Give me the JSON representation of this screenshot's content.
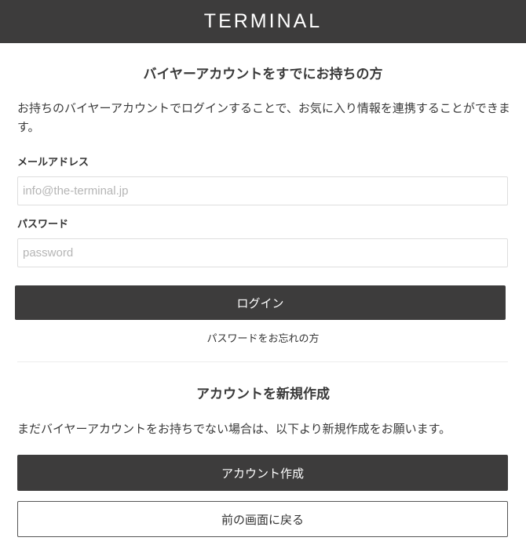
{
  "header": {
    "logo": "TERMINAL",
    "background_color": "#3d3c3c"
  },
  "login_section": {
    "title": "バイヤーアカウントをすでにお持ちの方",
    "description": "お持ちのバイヤーアカウントでログインすることで、お気に入り情報を連携することができます。",
    "email_label": "メールアドレス",
    "email_placeholder": "info@the-terminal.jp",
    "email_value": "",
    "password_label": "パスワード",
    "password_placeholder": "password",
    "password_value": "",
    "login_button": "ログイン",
    "forgot_password_link": "パスワードをお忘れの方"
  },
  "signup_section": {
    "title": "アカウントを新規作成",
    "description": "まだバイヤーアカウントをお持ちでない場合は、以下より新規作成をお願います。",
    "create_account_button": "アカウント作成",
    "back_button": "前の画面に戻る"
  }
}
